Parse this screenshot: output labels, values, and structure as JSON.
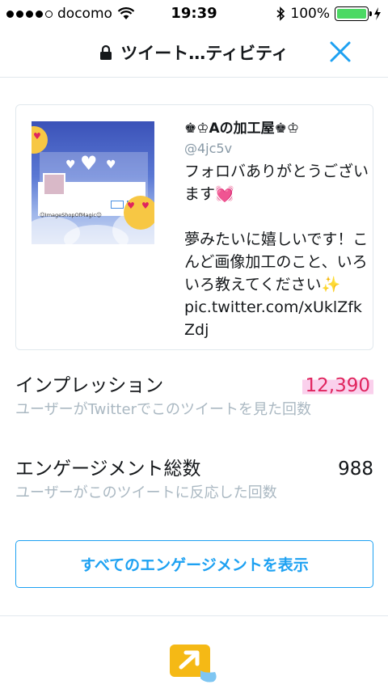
{
  "status_bar": {
    "carrier": "docomo",
    "time": "19:39",
    "battery_percent": "100%",
    "battery_color": "#4cd964"
  },
  "nav": {
    "title": "ツイート…ティビティ",
    "lock_icon": "lock-icon",
    "close_icon": "close-icon",
    "accent_color": "#1da1f2"
  },
  "tweet": {
    "name": "♚♔Aの加工屋♚♔",
    "handle": "@4jc5v",
    "text": "フォロバありがとうございます💓\n\n夢みたいに嬉しいです！こんど画像加工のこと、いろいろ教えてください✨\npic.twitter.com/xUklZfkZdj",
    "image_caption": "☺ImageShopOfMagic☺"
  },
  "stats": {
    "impressions": {
      "label": "インプレッション",
      "value": "12,390",
      "description": "ユーザーがTwitterでこのツイートを見た回数"
    },
    "engagements": {
      "label": "エンゲージメント総数",
      "value": "988",
      "description": "ユーザーがこのツイートに反応した回数"
    }
  },
  "actions": {
    "view_all_engagements": "すべてのエンゲージメントを表示"
  },
  "footer": {
    "promote_icon": "promote-tweet-icon",
    "promote_icon_color": "#f5b915"
  }
}
